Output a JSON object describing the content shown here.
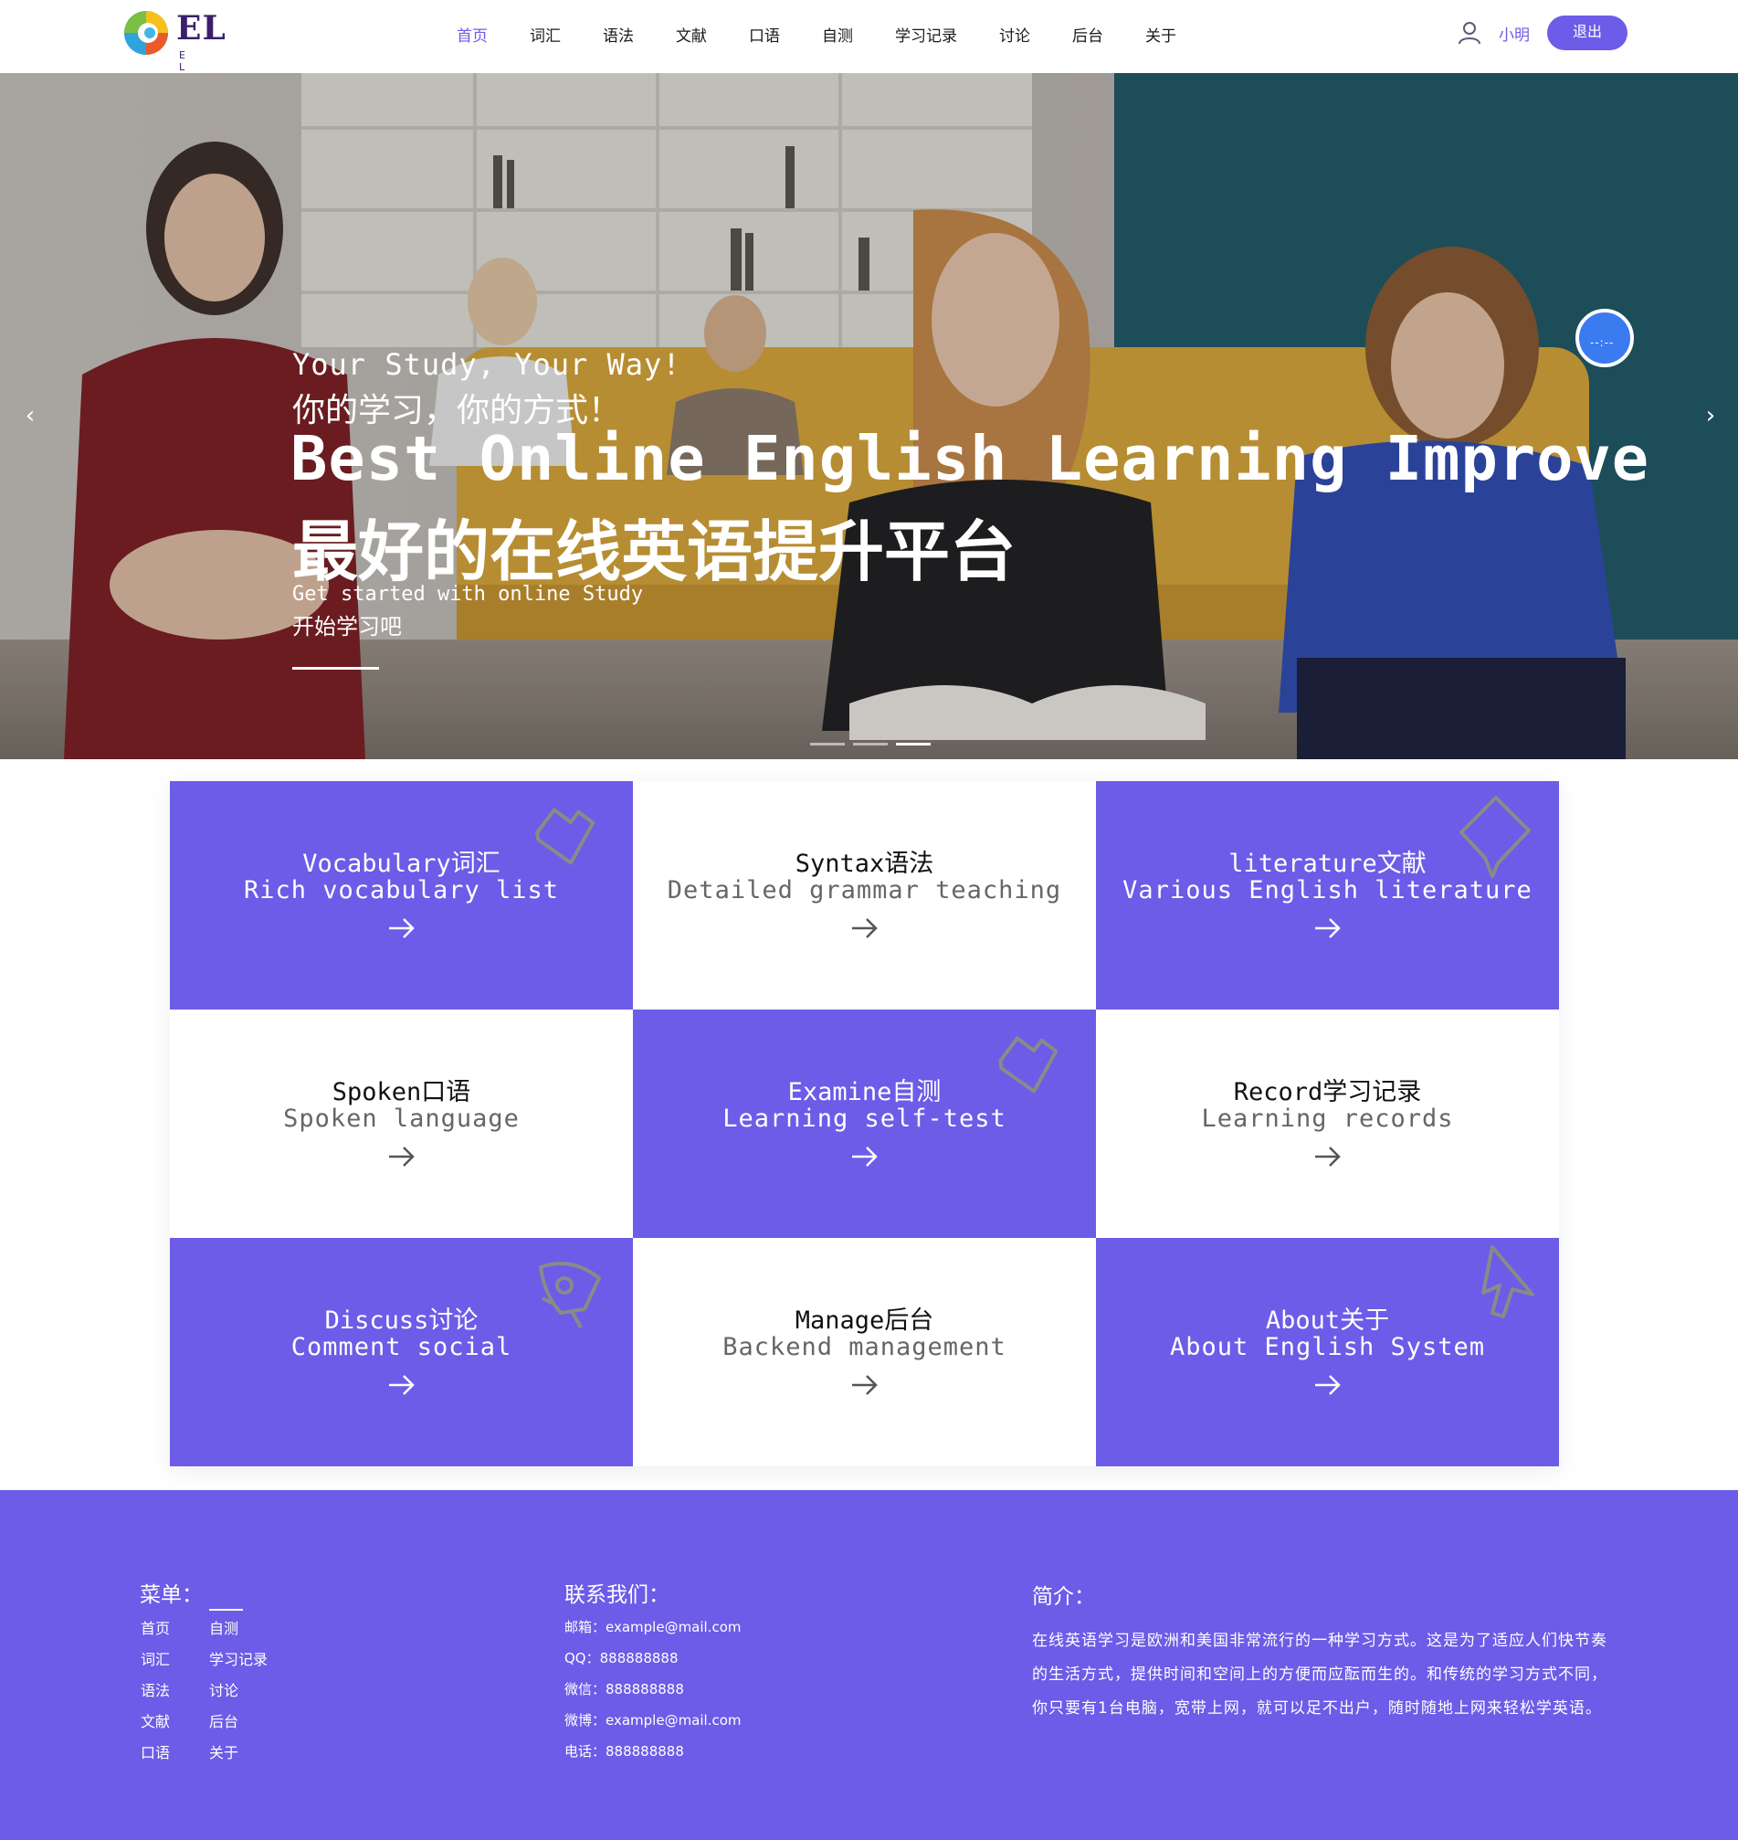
{
  "header": {
    "logo_text": "EL",
    "logo_sub": "E L",
    "nav": [
      {
        "label": "首页",
        "active": true
      },
      {
        "label": "词汇"
      },
      {
        "label": "语法"
      },
      {
        "label": "文献"
      },
      {
        "label": "口语"
      },
      {
        "label": "自测"
      },
      {
        "label": "学习记录"
      },
      {
        "label": "讨论"
      },
      {
        "label": "后台"
      },
      {
        "label": "关于"
      }
    ],
    "user_name": "小明",
    "logout_label": "退出"
  },
  "hero": {
    "line1": "Your Study, Your Way!",
    "line2": "你的学习，你的方式！",
    "title_en": "Best Online English Learning Improve",
    "title_zh": "最好的在线英语提升平台",
    "sub_en": "Get started with online Study",
    "sub_zh": "开始学习吧",
    "prev_arrow": "‹",
    "next_arrow": "›",
    "badge_text": "--:--",
    "slide_count": 3,
    "active_slide": 3
  },
  "cards": [
    {
      "title": "Vocabulary词汇",
      "subtitle": "Rich vocabulary list",
      "style": "purple",
      "icon": "tag-icon"
    },
    {
      "title": "Syntax语法",
      "subtitle": "Detailed grammar teaching",
      "style": "white"
    },
    {
      "title": "literature文献",
      "subtitle": "Various English literature",
      "style": "purple",
      "icon": "label-tag-icon"
    },
    {
      "title": "Spoken口语",
      "subtitle": "Spoken language",
      "style": "white"
    },
    {
      "title": "Examine自测",
      "subtitle": "Learning self-test",
      "style": "purple",
      "icon": "tag-icon"
    },
    {
      "title": "Record学习记录",
      "subtitle": "Learning records",
      "style": "white"
    },
    {
      "title": "Discuss讨论",
      "subtitle": "Comment social",
      "style": "purple",
      "icon": "rocket-icon"
    },
    {
      "title": "Manage后台",
      "subtitle": "Backend management",
      "style": "white"
    },
    {
      "title": "About关于",
      "subtitle": "About English System",
      "style": "purple",
      "icon": "cursor-icon"
    }
  ],
  "footer": {
    "menu_title": "菜单：",
    "menu_left": [
      "首页",
      "词汇",
      "语法",
      "文献",
      "口语"
    ],
    "menu_right": [
      "自测",
      "学习记录",
      "讨论",
      "后台",
      "关于"
    ],
    "contact_title": "联系我们：",
    "contacts": [
      "邮箱：example@mail.com",
      "QQ：888888888",
      "微信：888888888",
      "微博：example@mail.com",
      "电话：888888888"
    ],
    "intro_title": "简介：",
    "intro_text": "在线英语学习是欧洲和美国非常流行的一种学习方式。这是为了适应人们快节奏的生活方式，提供时间和空间上的方便而应酝而生的。和传统的学习方式不同，你只要有1台电脑，宽带上网，就可以足不出户，随时随地上网来轻松学英语。"
  },
  "colors": {
    "accent": "#6c5ce7",
    "white": "#ffffff",
    "text_dark": "#111111",
    "text_gray": "#666666"
  }
}
